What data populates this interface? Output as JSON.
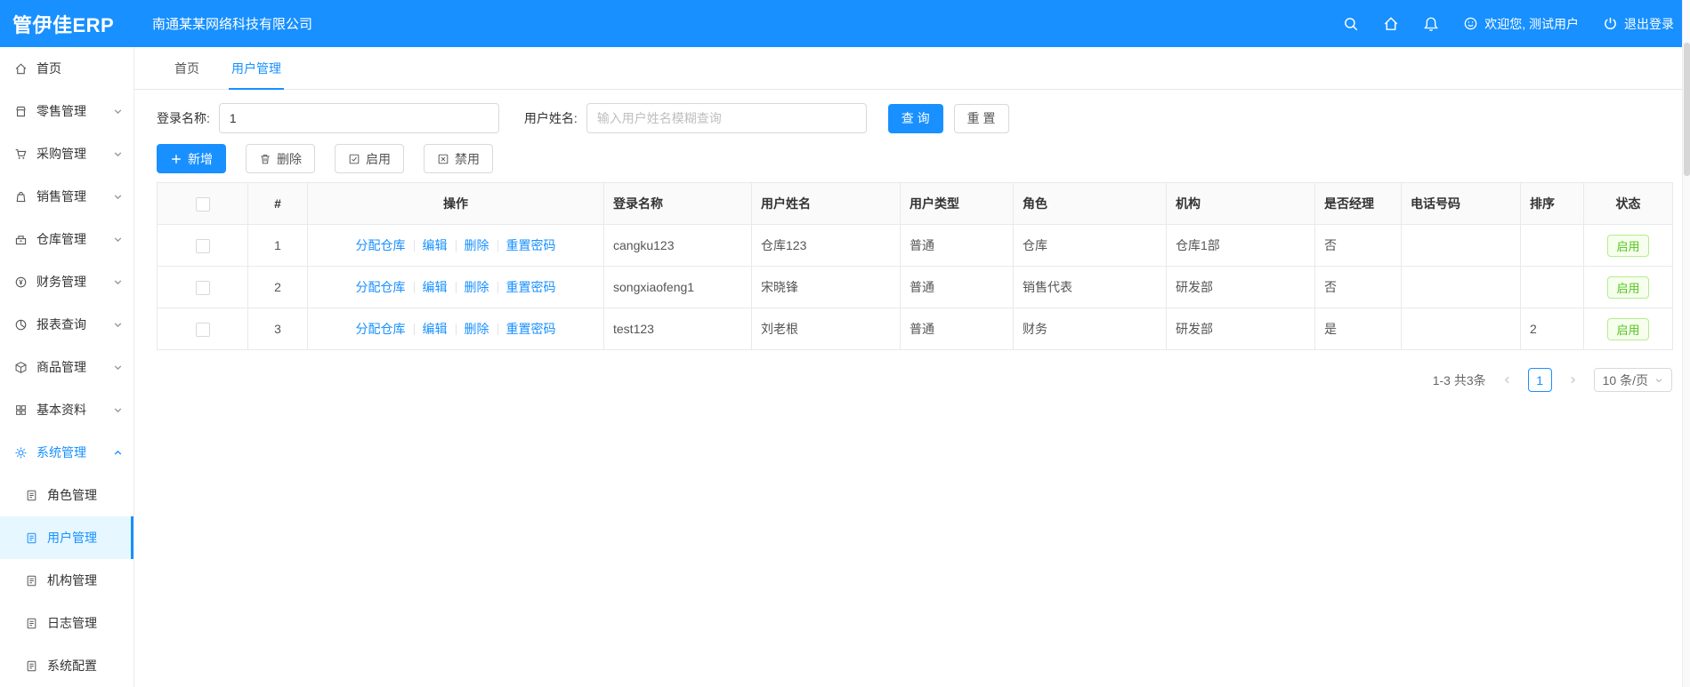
{
  "header": {
    "logo": "管伊佳ERP",
    "company": "南通某某网络科技有限公司",
    "welcome": "欢迎您, 测试用户",
    "logout": "退出登录"
  },
  "sidebar": {
    "items": [
      {
        "label": "首页",
        "icon": "home-icon",
        "expandable": false
      },
      {
        "label": "零售管理",
        "icon": "retail-icon",
        "expandable": true
      },
      {
        "label": "采购管理",
        "icon": "procurement-icon",
        "expandable": true
      },
      {
        "label": "销售管理",
        "icon": "sales-icon",
        "expandable": true
      },
      {
        "label": "仓库管理",
        "icon": "warehouse-icon",
        "expandable": true
      },
      {
        "label": "财务管理",
        "icon": "finance-icon",
        "expandable": true
      },
      {
        "label": "报表查询",
        "icon": "reports-icon",
        "expandable": true
      },
      {
        "label": "商品管理",
        "icon": "goods-icon",
        "expandable": true
      },
      {
        "label": "基本资料",
        "icon": "basic-data-icon",
        "expandable": true
      },
      {
        "label": "系统管理",
        "icon": "gear-icon",
        "expandable": true,
        "expanded": true
      }
    ],
    "sub_items": [
      {
        "label": "角色管理",
        "active": false
      },
      {
        "label": "用户管理",
        "active": true
      },
      {
        "label": "机构管理",
        "active": false
      },
      {
        "label": "日志管理",
        "active": false
      },
      {
        "label": "系统配置",
        "active": false
      }
    ]
  },
  "tabs": [
    {
      "label": "首页",
      "active": false
    },
    {
      "label": "用户管理",
      "active": true
    }
  ],
  "filters": {
    "login_label": "登录名称:",
    "login_value": "1",
    "name_label": "用户姓名:",
    "name_placeholder": "输入用户姓名模糊查询",
    "search_button": "查 询",
    "reset_button": "重 置"
  },
  "toolbar": {
    "add": "新增",
    "delete": "删除",
    "enable": "启用",
    "disable": "禁用"
  },
  "table": {
    "headers": [
      "#",
      "操作",
      "登录名称",
      "用户姓名",
      "用户类型",
      "角色",
      "机构",
      "是否经理",
      "电话号码",
      "排序",
      "状态"
    ],
    "action_links": [
      "分配仓库",
      "编辑",
      "删除",
      "重置密码"
    ],
    "rows": [
      {
        "index": "1",
        "login": "cangku123",
        "name": "仓库123",
        "type": "普通",
        "role": "仓库",
        "org": "仓库1部",
        "manager": "否",
        "phone": "",
        "sort": "",
        "status": "启用"
      },
      {
        "index": "2",
        "login": "songxiaofeng1",
        "name": "宋晓锋",
        "type": "普通",
        "role": "销售代表",
        "org": "研发部",
        "manager": "否",
        "phone": "",
        "sort": "",
        "status": "启用"
      },
      {
        "index": "3",
        "login": "test123",
        "name": "刘老根",
        "type": "普通",
        "role": "财务",
        "org": "研发部",
        "manager": "是",
        "phone": "",
        "sort": "2",
        "status": "启用"
      }
    ]
  },
  "pagination": {
    "total": "1-3 共3条",
    "page": "1",
    "page_size": "10 条/页"
  },
  "colors": {
    "primary": "#1890ff",
    "success": "#52c41a",
    "active_bg": "#e6f7ff"
  }
}
